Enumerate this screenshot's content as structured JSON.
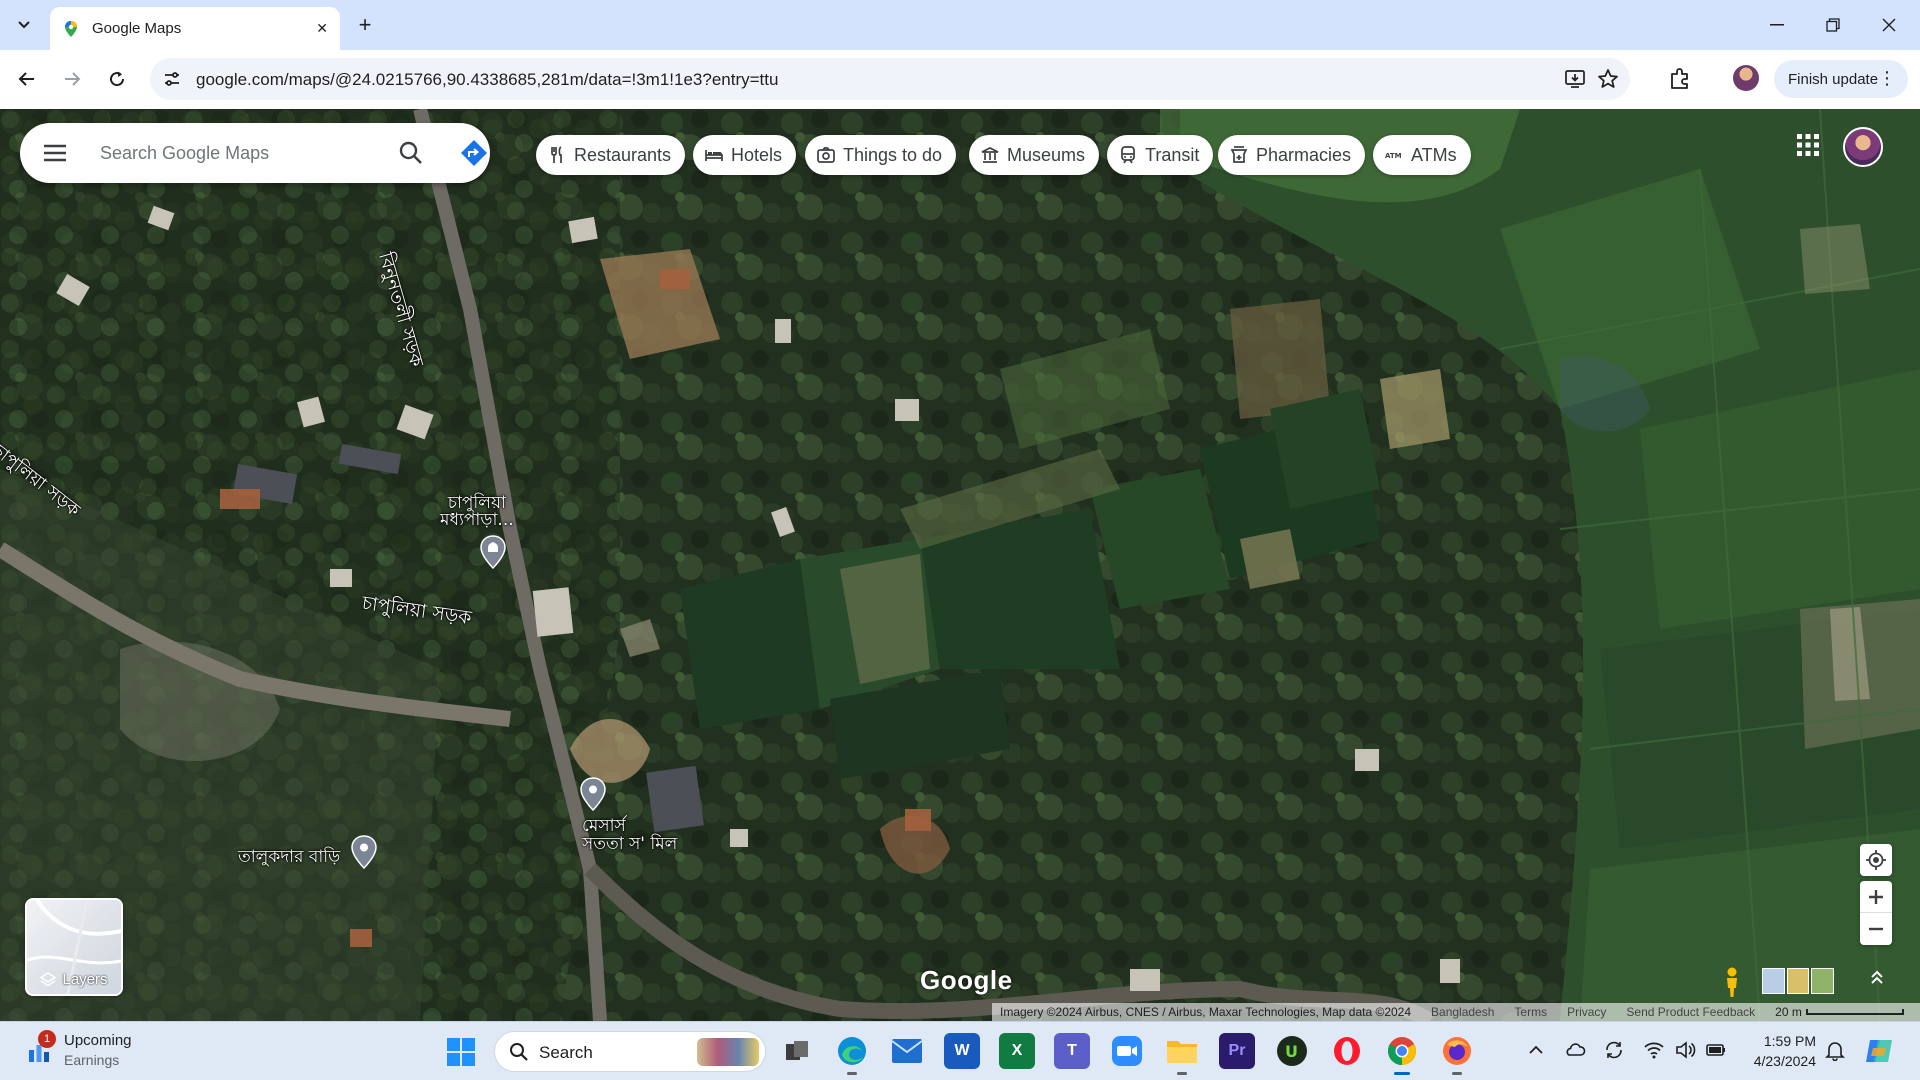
{
  "browser": {
    "tab": {
      "title": "Google Maps"
    },
    "url": "google.com/maps/@24.0215766,90.4338685,281m/data=!3m1!1e3?entry=ttu",
    "finish_update_label": "Finish update"
  },
  "map": {
    "search_placeholder": "Search Google Maps",
    "chips": [
      {
        "label": "Restaurants",
        "icon": "fork-knife-icon"
      },
      {
        "label": "Hotels",
        "icon": "bed-icon"
      },
      {
        "label": "Things to do",
        "icon": "camera-icon"
      },
      {
        "label": "Museums",
        "icon": "museum-icon"
      },
      {
        "label": "Transit",
        "icon": "train-icon"
      },
      {
        "label": "Pharmacies",
        "icon": "pharmacy-icon"
      },
      {
        "label": "ATMs",
        "icon": "atm-icon"
      }
    ],
    "road_labels": [
      "বিনুনতলী সড়ক",
      "চাপুলিয়া সড়ক",
      "চাপুলিয়া সড়ক"
    ],
    "place_labels": [
      {
        "line1": "চাপুলিয়া",
        "line2": "মধ্যপাড়া..."
      },
      {
        "line1": "মেসার্স",
        "line2": "সততা স' মিল"
      },
      {
        "line1": "তালুকদার বাড়ি",
        "line2": ""
      }
    ],
    "layers_label": "Layers",
    "logo": "Google",
    "attribution": {
      "imagery": "Imagery ©2024 Airbus, CNES / Airbus, Maxar Technologies, Map data ©2024",
      "country": "Bangladesh",
      "terms": "Terms",
      "privacy": "Privacy",
      "feedback": "Send Product Feedback",
      "scale": "20 m"
    }
  },
  "taskbar": {
    "weather": {
      "badge": "1",
      "title": "Upcoming",
      "subtitle": "Earnings"
    },
    "search_label": "Search",
    "apps": [
      "task-view",
      "edge",
      "mail",
      "word",
      "excel",
      "teams",
      "zoom",
      "file-explorer",
      "premiere-pro",
      "upwork",
      "opera",
      "chrome",
      "firefox"
    ],
    "clock": {
      "time": "1:59 PM",
      "date": "4/23/2024"
    }
  },
  "colors": {
    "tabbar": "#d3e3fd",
    "taskbar": "#dfe8f5",
    "directions_blue": "#1a73e8"
  }
}
